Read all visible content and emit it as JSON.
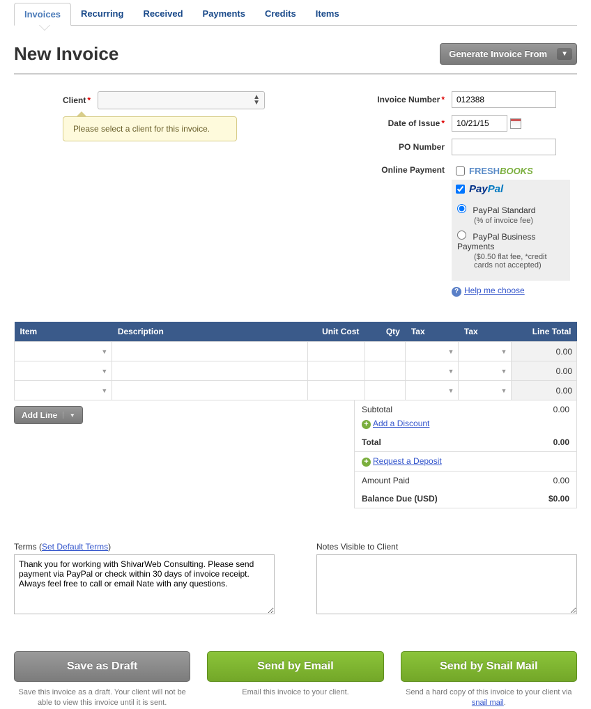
{
  "tabs": {
    "t0": "Invoices",
    "t1": "Recurring",
    "t2": "Received",
    "t3": "Payments",
    "t4": "Credits",
    "t5": "Items"
  },
  "page_title": "New Invoice",
  "generate_btn": "Generate Invoice From",
  "labels": {
    "client": "Client",
    "invoice_number": "Invoice Number",
    "date_of_issue": "Date of Issue",
    "po_number": "PO Number",
    "online_payment": "Online Payment"
  },
  "tooltip": "Please select a client for this invoice.",
  "fields": {
    "invoice_number": "012388",
    "date_of_issue": "10/21/15",
    "po_number": ""
  },
  "payment": {
    "freshbooks": {
      "checked": false
    },
    "paypal": {
      "checked": true
    },
    "paypal_standard": {
      "label": "PayPal Standard",
      "sub": "(% of invoice fee)",
      "selected": true
    },
    "paypal_business": {
      "label": "PayPal Business Payments",
      "sub": "($0.50 flat fee, *credit cards not accepted)",
      "selected": false
    },
    "help": "Help me choose"
  },
  "table": {
    "headers": {
      "item": "Item",
      "desc": "Description",
      "unit_cost": "Unit Cost",
      "qty": "Qty",
      "tax1": "Tax",
      "tax2": "Tax",
      "line_total": "Line Total"
    },
    "rows": [
      {
        "lt": "0.00"
      },
      {
        "lt": "0.00"
      },
      {
        "lt": "0.00"
      }
    ],
    "add_line": "Add Line"
  },
  "totals": {
    "subtotal_label": "Subtotal",
    "subtotal": "0.00",
    "add_discount": "Add a Discount",
    "total_label": "Total",
    "total": "0.00",
    "request_deposit": "Request a Deposit",
    "amount_paid_label": "Amount Paid",
    "amount_paid": "0.00",
    "balance_label": "Balance Due (USD)",
    "balance": "$0.00"
  },
  "terms": {
    "label_prefix": "Terms (",
    "set_default": "Set Default Terms",
    "label_suffix": ")",
    "value": "Thank you for working with ShivarWeb Consulting. Please send payment via PayPal or check within 30 days of invoice receipt. Always feel free to call or email Nate with any questions."
  },
  "notes": {
    "label": "Notes Visible to Client",
    "value": ""
  },
  "actions": {
    "draft": {
      "label": "Save as Draft",
      "hint": "Save this invoice as a draft. Your client will not be able to view this invoice until it is sent."
    },
    "email": {
      "label": "Send by Email",
      "hint": "Email this invoice to your client."
    },
    "snail": {
      "label": "Send by Snail Mail",
      "hint_prefix": "Send a hard copy of this invoice to your client via ",
      "hint_link": "snail mail",
      "hint_suffix": "."
    }
  }
}
